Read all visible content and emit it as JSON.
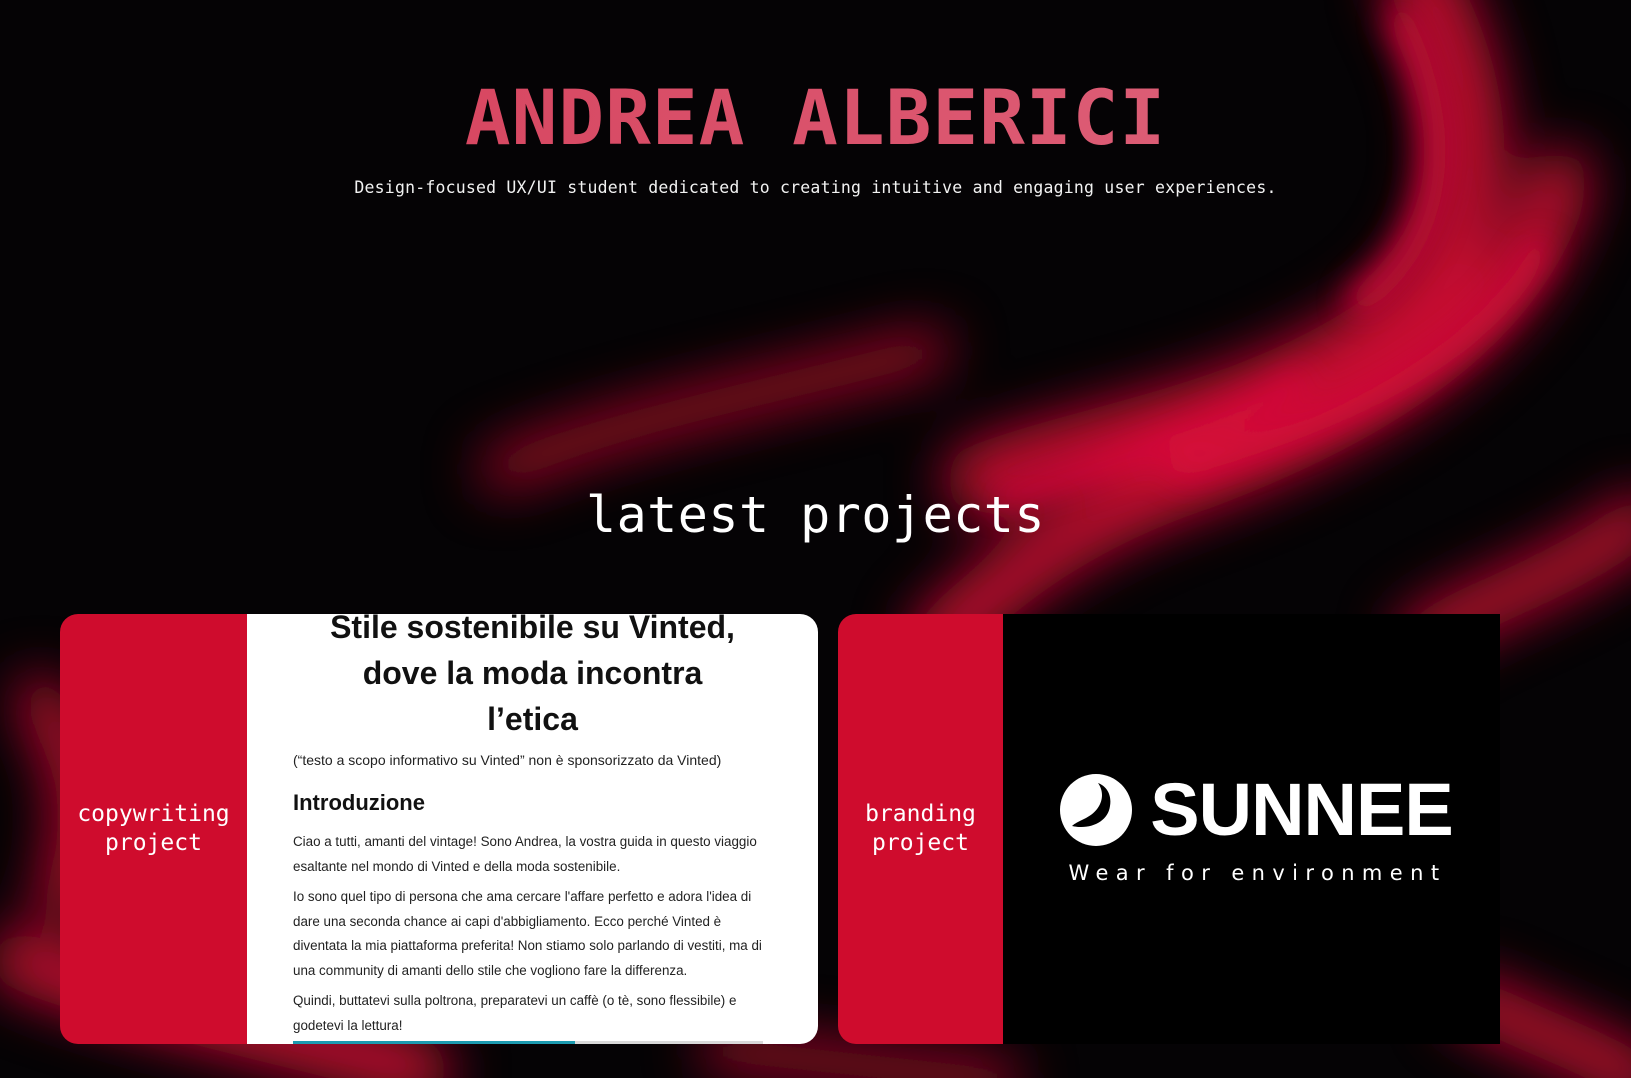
{
  "hero": {
    "title": "ANDREA ALBERICI",
    "subtitle": "Design-focused UX/UI student dedicated to creating intuitive and engaging user experiences."
  },
  "section": {
    "title": "latest projects"
  },
  "projects": [
    {
      "label_line1": "copywriting",
      "label_line2": "project",
      "preview": {
        "title_line1": "Stile sostenibile su Vinted,",
        "title_line2": "dove la moda incontra",
        "title_line3": "l’etica",
        "note": "(“testo a scopo informativo su Vinted” non è sponsorizzato da Vinted)",
        "heading": "Introduzione",
        "paragraphs": [
          "Ciao a tutti, amanti del vintage! Sono Andrea, la vostra guida in questo viaggio esaltante nel mondo di Vinted e della moda sostenibile.",
          "Io sono quel tipo di persona che ama cercare l'affare perfetto e adora l'idea di dare una seconda chance ai capi d'abbigliamento. Ecco perché Vinted è diventata la mia piattaforma preferita! Non stiamo solo parlando di vestiti, ma di una community di amanti dello stile che vogliono fare la differenza.",
          "Quindi, buttatevi sulla poltrona, preparatevi un caffè (o tè, sono flessibile) e godetevi la lettura!"
        ]
      }
    },
    {
      "label_line1": "branding",
      "label_line2": "project",
      "preview": {
        "brand_name": "SUNNEE",
        "tagline": "Wear for environment"
      }
    }
  ],
  "colors": {
    "background": "#050305",
    "accent": "#cf0c2d",
    "title_gradient_start": "#d43a55",
    "title_gradient_end": "#e06a82"
  }
}
